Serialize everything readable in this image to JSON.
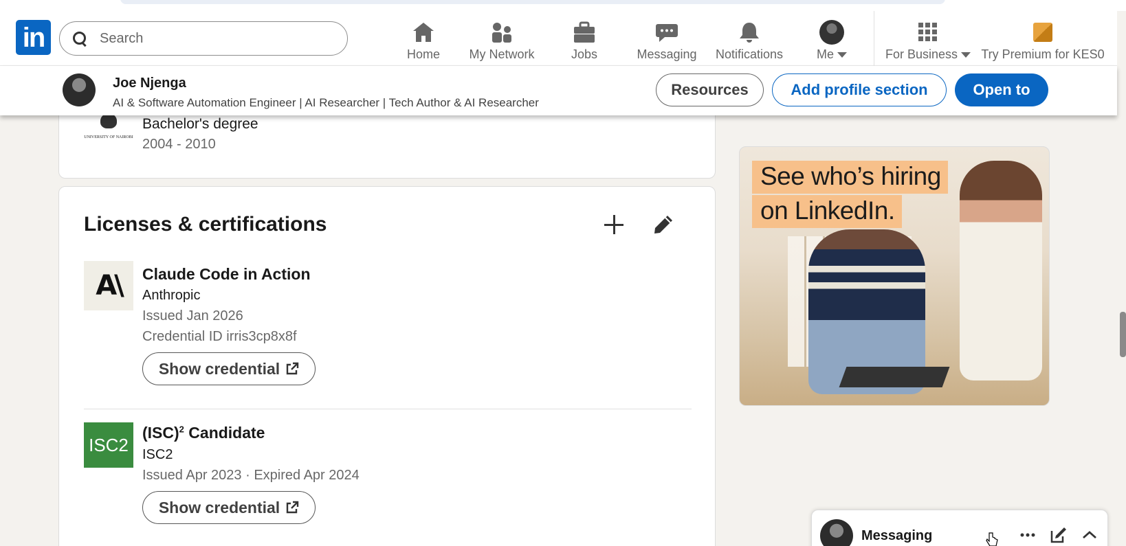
{
  "nav": {
    "logo_text": "in",
    "search_placeholder": "Search",
    "items": [
      {
        "label": "Home",
        "icon": "home-icon"
      },
      {
        "label": "My Network",
        "icon": "network-icon"
      },
      {
        "label": "Jobs",
        "icon": "briefcase-icon"
      },
      {
        "label": "Messaging",
        "icon": "chat-icon"
      },
      {
        "label": "Notifications",
        "icon": "bell-icon"
      },
      {
        "label": "Me",
        "icon": "avatar"
      },
      {
        "label": "For Business",
        "icon": "grid-icon"
      },
      {
        "label": "Try Premium for KES0",
        "icon": "premium-icon"
      }
    ]
  },
  "sticky": {
    "name": "Joe Njenga",
    "headline": "AI & Software Automation Engineer | AI Researcher | Tech Author & AI Researcher",
    "resources_label": "Resources",
    "add_section_label": "Add profile section",
    "open_to_label": "Open to"
  },
  "education": {
    "school_caption": "UNIVERSITY OF NAIROBI",
    "degree": "Bachelor's degree",
    "years": "2004 - 2010"
  },
  "licenses": {
    "title": "Licenses & certifications",
    "items": [
      {
        "logo_text": "A\\",
        "name": "Claude Code in Action",
        "issuer": "Anthropic",
        "issued": "Issued Jan 2026",
        "credential_id": "Credential ID irris3cp8x8f",
        "button": "Show credential"
      },
      {
        "logo_text": "ISC2",
        "name_prefix": "(ISC)",
        "name_sup": "2",
        "name_suffix": " Candidate",
        "issuer": "ISC2",
        "issued": "Issued Apr 2023 · Expired Apr 2024",
        "button": "Show credential"
      }
    ]
  },
  "ad": {
    "line1": "See who’s hiring",
    "line2": "on LinkedIn."
  },
  "messaging": {
    "label": "Messaging"
  },
  "colors": {
    "brand_blue": "#0a66c2",
    "page_bg": "#f4f2ee",
    "isc2_green": "#3a8c3f",
    "ad_highlight": "#f7c08a"
  }
}
